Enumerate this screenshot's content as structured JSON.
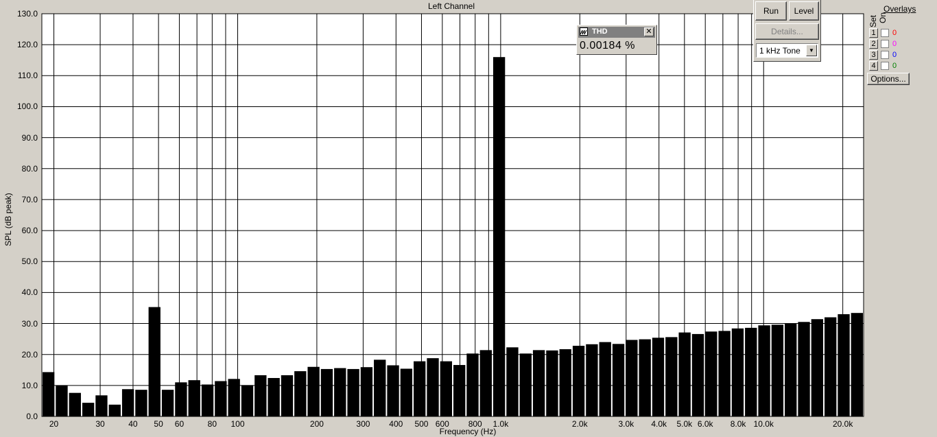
{
  "window": {
    "title": "Left Channel"
  },
  "controls": {
    "run_label": "Run",
    "level_label": "Level",
    "details_label": "Details...",
    "tone_value": "1 kHz Tone",
    "options_label": "Options..."
  },
  "overlays": {
    "title": "Overlays",
    "set_label": "Set",
    "on_label": "On",
    "rows": [
      {
        "num": "1",
        "value": "0",
        "color": "#ff0000"
      },
      {
        "num": "2",
        "value": "0",
        "color": "#ff00ff"
      },
      {
        "num": "3",
        "value": "0",
        "color": "#0000ff"
      },
      {
        "num": "4",
        "value": "0",
        "color": "#008000"
      }
    ]
  },
  "thd": {
    "title": "THD",
    "value": "0.00184 %"
  },
  "chart_data": {
    "type": "bar",
    "xlabel": "Frequency (Hz)",
    "ylabel": "SPL (dB peak)",
    "x_scale": "log",
    "xlim": [
      18,
      24000
    ],
    "ylim": [
      0,
      130
    ],
    "grid": true,
    "yticks": [
      "0.0",
      "10.0",
      "20.0",
      "30.0",
      "40.0",
      "50.0",
      "60.0",
      "70.0",
      "80.0",
      "90.0",
      "100.0",
      "110.0",
      "120.0",
      "130.0"
    ],
    "xtick_labels": [
      {
        "f": 20,
        "label": "20"
      },
      {
        "f": 30,
        "label": "30"
      },
      {
        "f": 40,
        "label": "40"
      },
      {
        "f": 50,
        "label": "50"
      },
      {
        "f": 60,
        "label": "60"
      },
      {
        "f": 80,
        "label": "80"
      },
      {
        "f": 100,
        "label": "100"
      },
      {
        "f": 200,
        "label": "200"
      },
      {
        "f": 300,
        "label": "300"
      },
      {
        "f": 400,
        "label": "400"
      },
      {
        "f": 500,
        "label": "500"
      },
      {
        "f": 600,
        "label": "600"
      },
      {
        "f": 800,
        "label": "800"
      },
      {
        "f": 1000,
        "label": "1.0k"
      },
      {
        "f": 2000,
        "label": "2.0k"
      },
      {
        "f": 3000,
        "label": "3.0k"
      },
      {
        "f": 4000,
        "label": "4.0k"
      },
      {
        "f": 5000,
        "label": "5.0k"
      },
      {
        "f": 6000,
        "label": "6.0k"
      },
      {
        "f": 8000,
        "label": "8.0k"
      },
      {
        "f": 10000,
        "label": "10.0k"
      },
      {
        "f": 20000,
        "label": "20.0k"
      }
    ],
    "values": [
      14.3,
      10.0,
      7.6,
      4.4,
      6.8,
      3.8,
      8.8,
      8.6,
      35.3,
      8.6,
      11.0,
      11.7,
      10.3,
      11.4,
      12.1,
      10.1,
      13.3,
      12.4,
      13.3,
      14.6,
      16.0,
      15.3,
      15.6,
      15.3,
      15.9,
      18.3,
      16.5,
      15.4,
      17.8,
      18.8,
      17.8,
      16.6,
      20.3,
      21.4,
      116.0,
      22.3,
      20.3,
      21.4,
      21.3,
      21.7,
      22.8,
      23.3,
      24.0,
      23.4,
      24.7,
      24.9,
      25.4,
      25.6,
      27.1,
      26.6,
      27.4,
      27.6,
      28.4,
      28.6,
      29.4,
      29.6,
      30.1,
      30.5,
      31.4,
      32.0,
      33.0,
      33.4
    ]
  }
}
